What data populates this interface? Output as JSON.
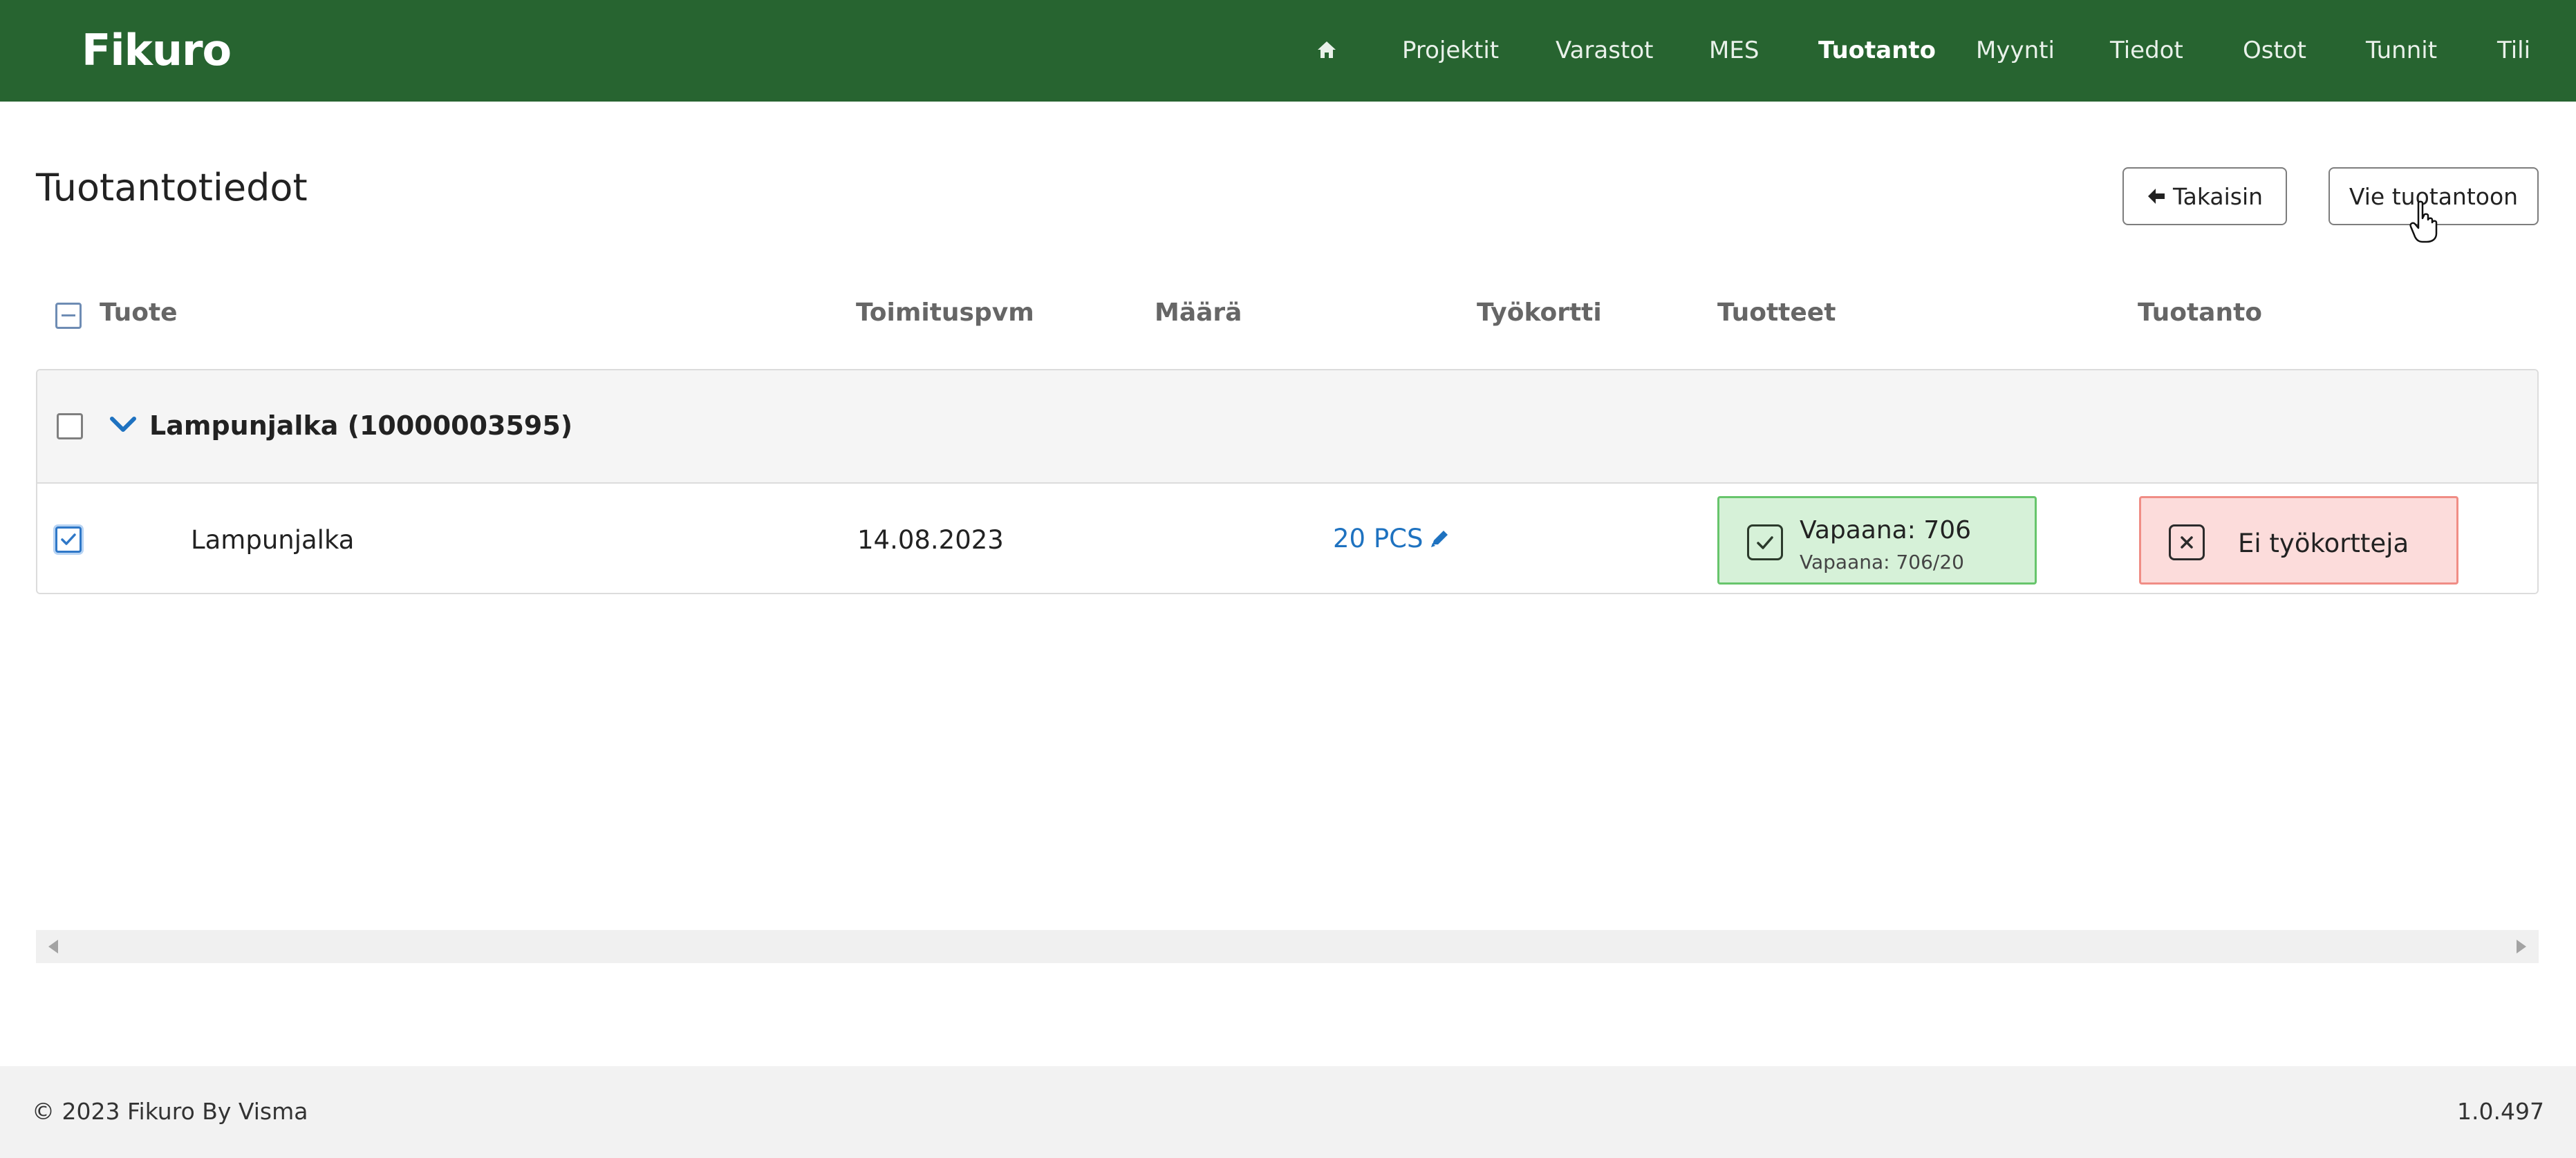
{
  "app": {
    "logo": "Fikuro"
  },
  "nav": {
    "home_icon": "home-icon",
    "items": [
      {
        "label": "Projektit"
      },
      {
        "label": "Varastot"
      },
      {
        "label": "MES"
      },
      {
        "label": "Tuotanto",
        "active": true
      },
      {
        "label": "Myynti"
      },
      {
        "label": "Tiedot"
      },
      {
        "label": "Ostot"
      },
      {
        "label": "Tunnit"
      },
      {
        "label": "Tili"
      }
    ]
  },
  "page": {
    "title": "Tuotantotiedot",
    "back_button": "Takaisin",
    "produce_button": "Vie tuotantoon"
  },
  "table": {
    "columns": [
      "Tuote",
      "Toimituspvm",
      "Määrä",
      "Työkortti",
      "Tuotteet",
      "Tuotanto"
    ],
    "group": {
      "label": "Lampunjalka (10000003595)",
      "expanded": true,
      "checked": false
    },
    "rows": [
      {
        "checked": true,
        "product": "Lampunjalka",
        "delivery_date": "14.08.2023",
        "quantity": "20 PCS",
        "products_status": {
          "title": "Vapaana: 706",
          "detail": "Vapaana: 706/20",
          "state": "ok"
        },
        "production_status": {
          "text": "Ei työkortteja",
          "state": "error"
        }
      }
    ]
  },
  "footer": {
    "copyright": "© 2023 Fikuro By Visma",
    "version": "1.0.497"
  },
  "colors": {
    "nav_bg": "#276430",
    "accent_blue": "#1e72c0",
    "ok_bg": "#d6f1d8",
    "ok_border": "#67c56c",
    "error_bg": "#fcdcdb",
    "error_border": "#f08d85"
  }
}
